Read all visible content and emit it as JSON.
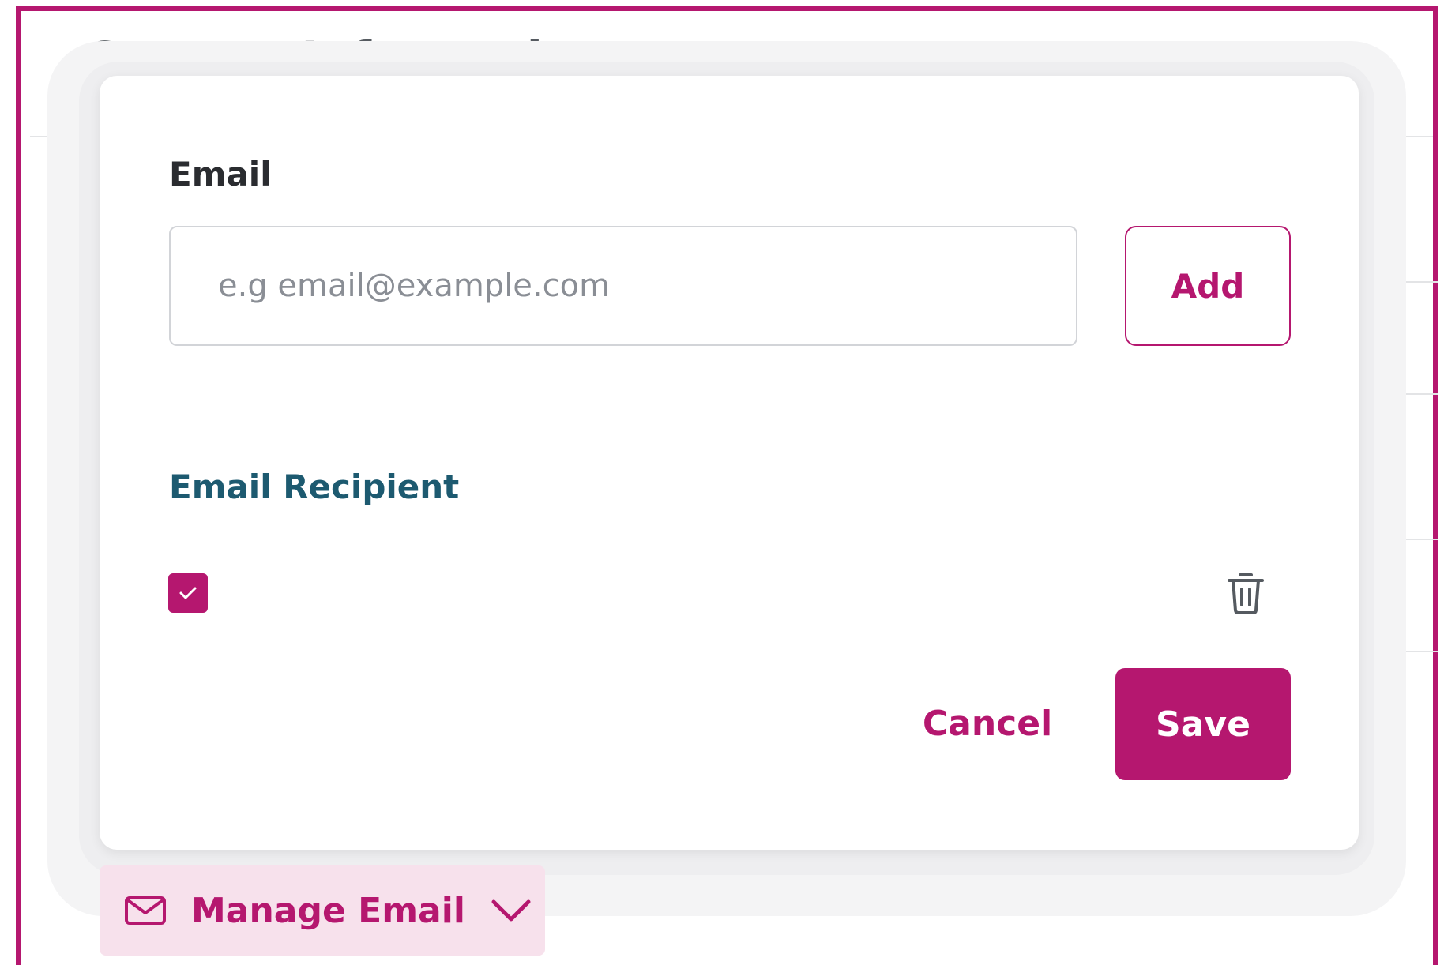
{
  "page": {
    "title": "Contact Information"
  },
  "modal": {
    "email_label": "Email",
    "email_input": {
      "value": "",
      "placeholder": "e.g email@example.com"
    },
    "add_label": "Add",
    "recipient_heading": "Email Recipient",
    "recipients": [
      {
        "checked": true,
        "address": ""
      }
    ],
    "cancel_label": "Cancel",
    "save_label": "Save"
  },
  "manage_email": {
    "label": "Manage Email",
    "icon": "mail-icon",
    "chevron": "chevron-down-icon"
  },
  "colors": {
    "accent": "#b5176f",
    "heading_teal": "#1d5a70",
    "manage_bg": "#f7e1ec"
  }
}
